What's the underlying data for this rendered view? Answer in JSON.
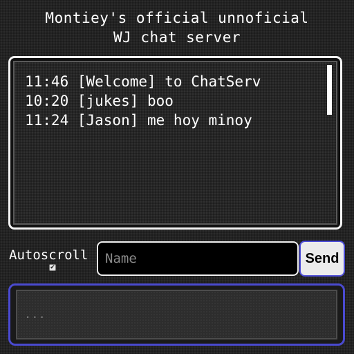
{
  "header": {
    "title_line1": "Montiey's official unnoficial",
    "title_line2": "WJ chat server"
  },
  "chat": {
    "messages": [
      {
        "text": "11:46 [Welcome] to ChatServ"
      },
      {
        "text": "10:20 [jukes] boo"
      },
      {
        "text": "11:24 [Jason] me hoy minoy"
      }
    ]
  },
  "controls": {
    "autoscroll_label": "Autoscroll",
    "autoscroll_checked": true,
    "name_placeholder": "Name",
    "name_value": "",
    "send_label": "Send",
    "message_placeholder": "...",
    "message_value": ""
  },
  "colors": {
    "accent": "#4a4ad0",
    "background": "#232323",
    "text": "#ffffff"
  }
}
